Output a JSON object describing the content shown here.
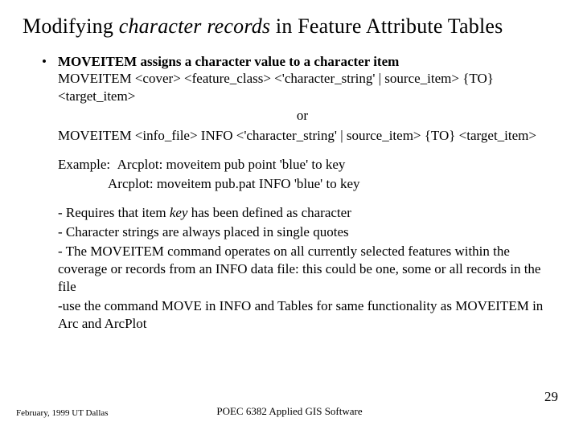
{
  "title": {
    "pre": "Modifying ",
    "ital": "character records",
    "post": " in Feature Attribute Tables"
  },
  "bullet": {
    "marker": "•",
    "lead_bold": "MOVEITEM assigns a character value to a character item"
  },
  "syntax": {
    "line1": "MOVEITEM <cover> <feature_class> <'character_string' | source_item> {TO} <target_item>",
    "or": "or",
    "line2": "MOVEITEM <info_file> INFO <'character_string' | source_item> {TO} <target_item>"
  },
  "example": {
    "label": "Example:",
    "l1": "Arcplot:  moveitem pub point 'blue' to key",
    "l2": "Arcplot:  moveitem pub.pat INFO 'blue' to key"
  },
  "notes": {
    "n1a": "- Requires that item ",
    "n1_ital": "key",
    "n1b": " has been defined as character",
    "n2": "- Character strings are always placed in single quotes",
    "n3": "- The MOVEITEM command operates on all currently selected features within the coverage or records from an INFO data file: this could be one, some or all records in the file",
    "n4": "-use the command MOVE in INFO and Tables for same functionality as MOVEITEM in Arc and ArcPlot"
  },
  "footer": {
    "left": "February, 1999  UT Dallas",
    "center": "POEC 6382 Applied GIS Software",
    "right": "29"
  }
}
